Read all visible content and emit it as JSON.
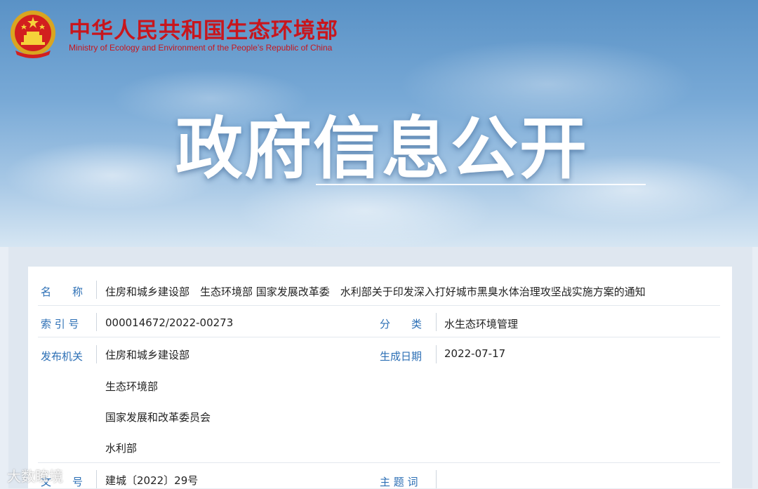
{
  "header": {
    "ministry_cn": "中华人民共和国生态环境部",
    "ministry_en": "Ministry of Ecology and Environment of the People’s Republic of China",
    "hero_title": "政府信息公开"
  },
  "info": {
    "name_label": "名　　称",
    "name_value": "住房和城乡建设部　生态环境部 国家发展改革委　水利部关于印发深入打好城市黑臭水体治理攻坚战实施方案的通知",
    "index_label": "索 引 号",
    "index_value": "000014672/2022-00273",
    "category_label": "分　　类",
    "category_value": "水生态环境管理",
    "issuer_label": "发布机关",
    "issuers": [
      "住房和城乡建设部",
      "生态环境部",
      "国家发展和改革委员会",
      "水利部"
    ],
    "date_label": "生成日期",
    "date_value": "2022-07-17",
    "docno_label": "文　　号",
    "docno_value": "建城〔2022〕29号",
    "topic_label": "主 题 词",
    "topic_value": ""
  },
  "watermark": "大数瞭境",
  "colors": {
    "accent_red": "#c8161d",
    "label_blue": "#2c6fb5"
  },
  "icons": {
    "emblem": "national-emblem-icon"
  }
}
